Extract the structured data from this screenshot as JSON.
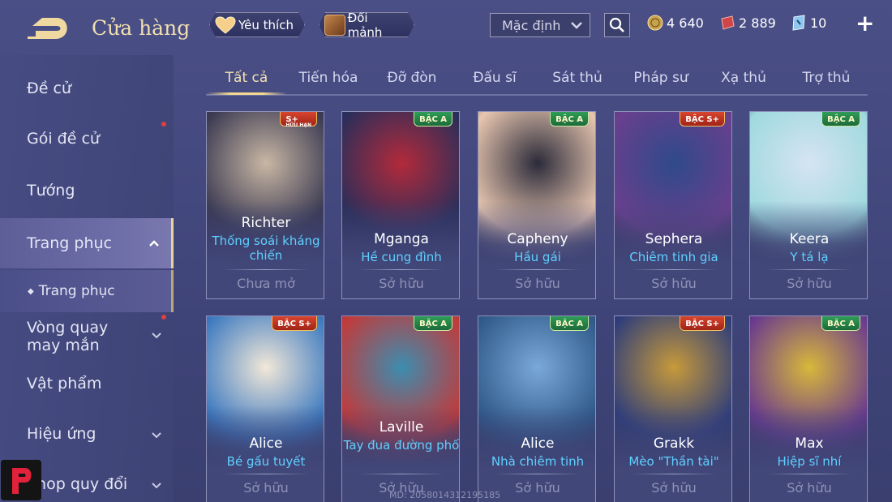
{
  "header": {
    "title": "Cửa hàng",
    "favorite_label": "Yêu thích",
    "shard_label": "Đổi mảnh",
    "sort_value": "Mặc định",
    "currencies": [
      {
        "icon": "gold-coin-icon",
        "value": "4 640"
      },
      {
        "icon": "red-voucher-icon",
        "value": "2 889"
      },
      {
        "icon": "blue-ticket-icon",
        "value": "10"
      }
    ],
    "plus": "+"
  },
  "sidebar": {
    "items": [
      {
        "label": "Đề cử"
      },
      {
        "label": "Gói đề cử"
      },
      {
        "label": "Tướng"
      },
      {
        "label": "Trang phục"
      },
      {
        "label": "Trang phục"
      },
      {
        "label": "Vòng quay may mắn"
      },
      {
        "label": "Vật phẩm"
      },
      {
        "label": "Hiệu ứng"
      },
      {
        "label": "Shop quy đổi"
      }
    ]
  },
  "tabs": [
    "Tất cả",
    "Tiến hóa",
    "Đỡ đòn",
    "Đấu sĩ",
    "Sát thủ",
    "Pháp sư",
    "Xạ thủ",
    "Trợ thủ"
  ],
  "cards": [
    {
      "hero": "Richter",
      "skin": "Thống soái kháng chiến",
      "status": "Chưa mở",
      "badge": "S+",
      "badge_sub": "HỮU HẠN",
      "colors": [
        "#3b3a52",
        "#c9b7a4"
      ]
    },
    {
      "hero": "Mganga",
      "skin": "Hề cung đình",
      "status": "Sở hữu",
      "badge": "BẬC A",
      "colors": [
        "#2a2e5a",
        "#b32a3a"
      ]
    },
    {
      "hero": "Capheny",
      "skin": "Hầu gái",
      "status": "Sở hữu",
      "badge": "BẬC A",
      "colors": [
        "#e8c6b0",
        "#2b2b3a"
      ]
    },
    {
      "hero": "Sephera",
      "skin": "Chiêm tinh gia",
      "status": "Sở hữu",
      "badge": "BẬC S+",
      "colors": [
        "#6a3f8e",
        "#2f4a8a"
      ]
    },
    {
      "hero": "Keera",
      "skin": "Y tá lạ",
      "status": "Sở hữu",
      "badge": "BẬC A",
      "colors": [
        "#9fd9df",
        "#d6e4f2"
      ]
    },
    {
      "hero": "Alice",
      "skin": "Bé gấu tuyết",
      "status": "Sở hữu",
      "badge": "BẬC S+",
      "colors": [
        "#3d7ac0",
        "#f2e8d8"
      ]
    },
    {
      "hero": "Laville",
      "skin": "Tay đua đường phố",
      "status": "Sở hữu",
      "badge": "BẬC A",
      "colors": [
        "#c23a3a",
        "#3c8db0"
      ]
    },
    {
      "hero": "Alice",
      "skin": "Nhà chiêm tinh",
      "status": "Sở hữu",
      "badge": "BẬC A",
      "colors": [
        "#2f5a8a",
        "#7aa8d8"
      ]
    },
    {
      "hero": "Grakk",
      "skin": "Mèo \"Thần tài\"",
      "status": "Sở hữu",
      "badge": "BẬC S+",
      "colors": [
        "#2e3d7a",
        "#c79a3a"
      ]
    },
    {
      "hero": "Max",
      "skin": "Hiệp sĩ nhí",
      "status": "Sở hữu",
      "badge": "BẬC A",
      "colors": [
        "#6a3a8e",
        "#d8b83a"
      ]
    }
  ],
  "watermark": "MD: 2058014312195185",
  "colors": {
    "accent_gold": "#f1dfb0",
    "skin_blue": "#5fd0ff",
    "notify_red": "#e04040"
  }
}
